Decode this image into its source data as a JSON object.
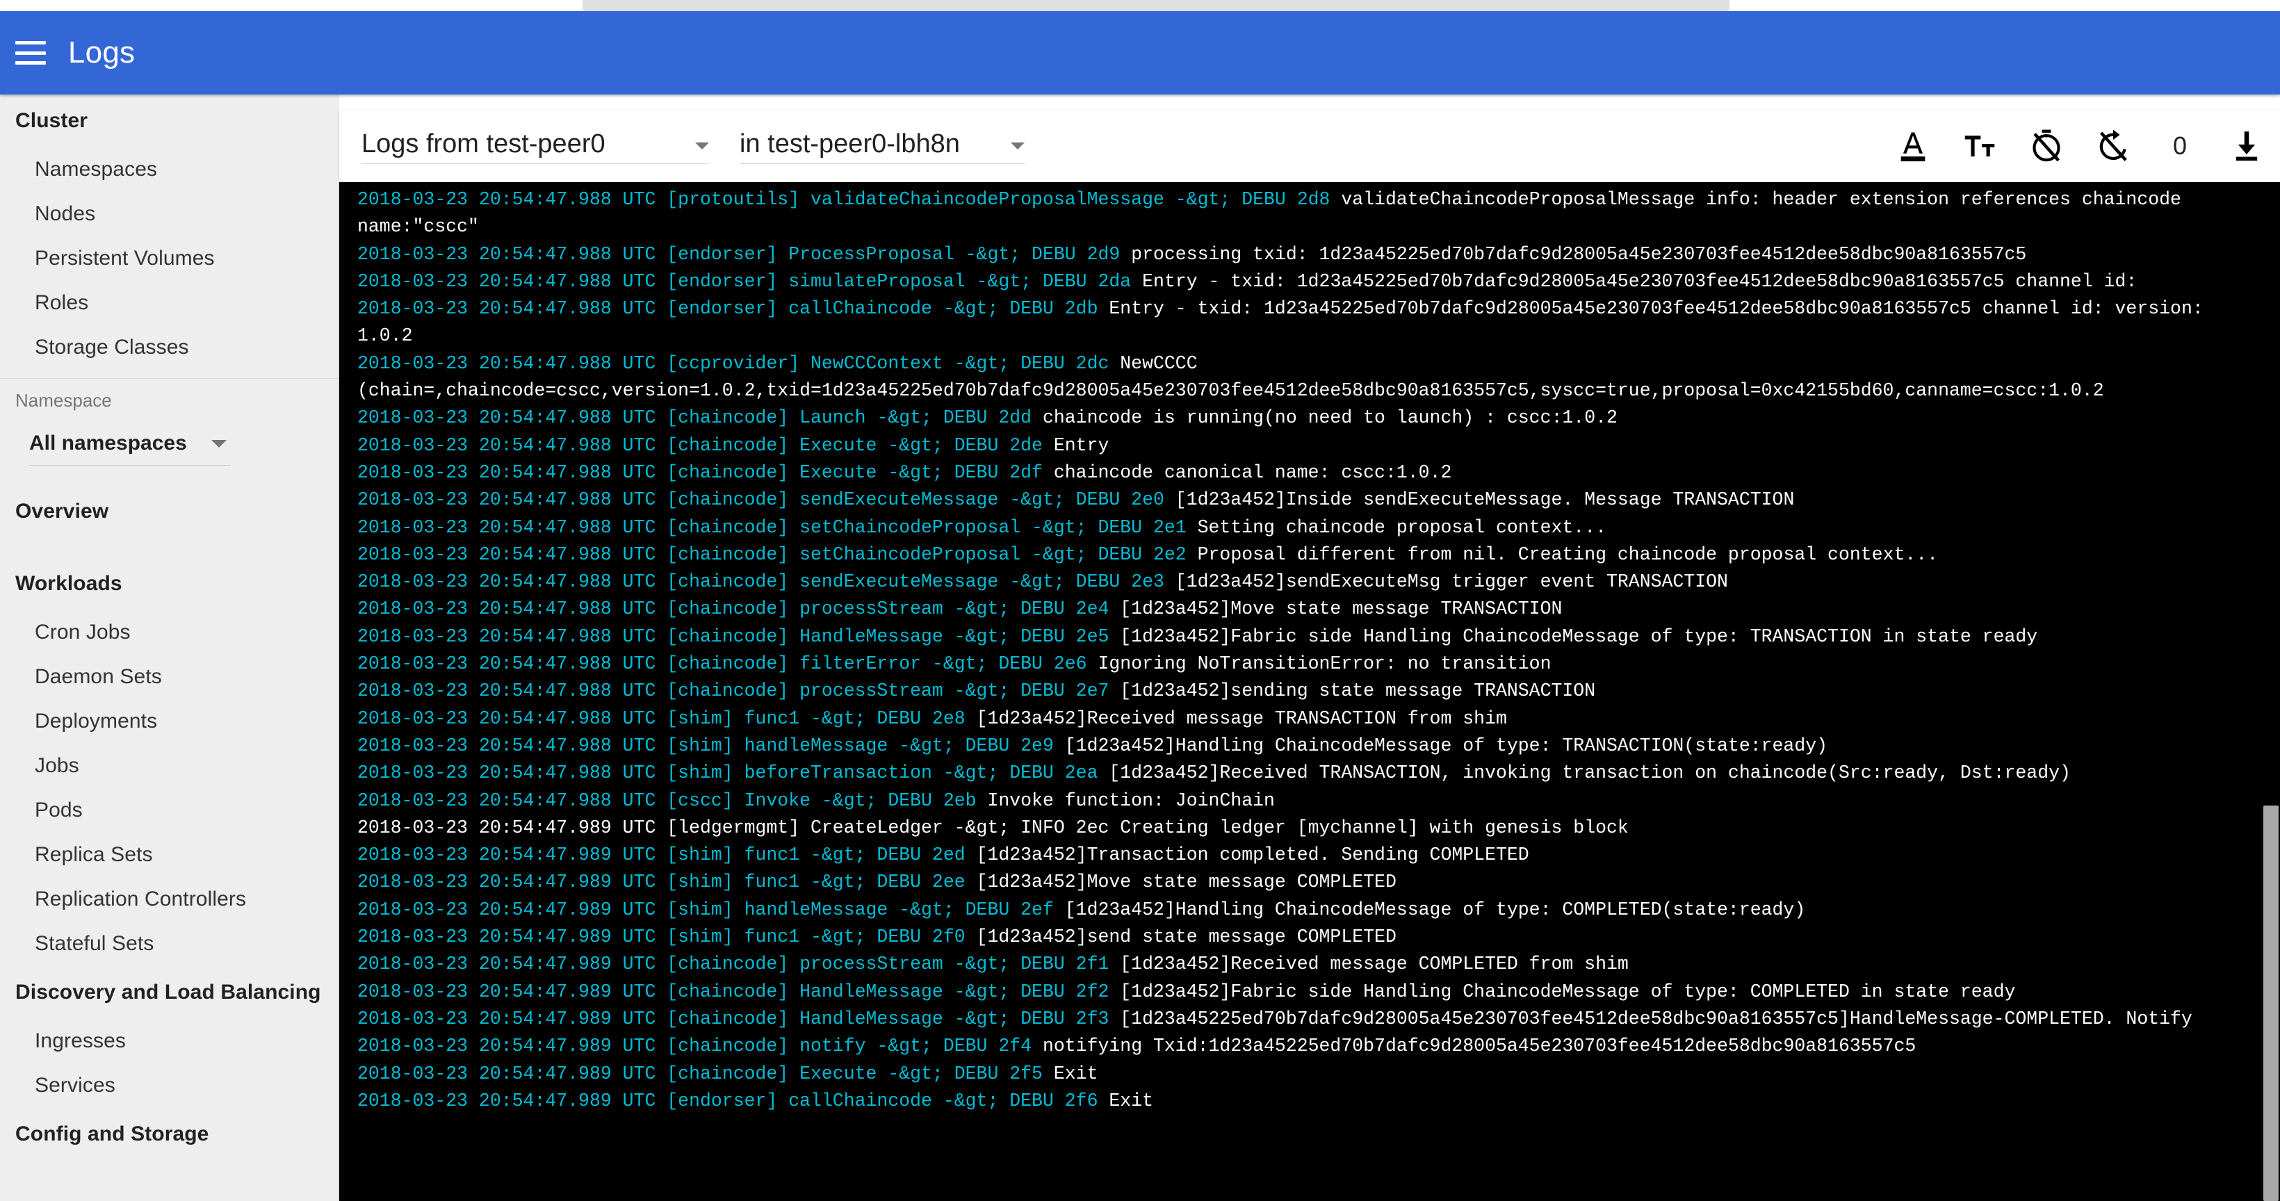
{
  "appbar": {
    "title": "Logs",
    "menu_icon": "hamburger-menu-icon"
  },
  "sidebar": {
    "sections": [
      {
        "title": "Cluster",
        "items": [
          "Namespaces",
          "Nodes",
          "Persistent Volumes",
          "Roles",
          "Storage Classes"
        ]
      }
    ],
    "namespace": {
      "label": "Namespace",
      "selected": "All namespaces"
    },
    "overview": "Overview",
    "workloads": {
      "title": "Workloads",
      "items": [
        "Cron Jobs",
        "Daemon Sets",
        "Deployments",
        "Jobs",
        "Pods",
        "Replica Sets",
        "Replication Controllers",
        "Stateful Sets"
      ]
    },
    "discovery": {
      "title": "Discovery and Load Balancing",
      "items": [
        "Ingresses",
        "Services"
      ]
    },
    "config": {
      "title": "Config and Storage"
    }
  },
  "toolbar": {
    "pod_selector": "Logs from test-peer0",
    "container_selector": "in test-peer0-lbh8n",
    "icons": [
      {
        "name": "font-color-icon",
        "label": "A"
      },
      {
        "name": "font-size-icon",
        "label": "Tt"
      },
      {
        "name": "timestamp-off-icon",
        "label": "timestamp-off"
      },
      {
        "name": "auto-refresh-off-icon",
        "label": "auto-refresh-off"
      }
    ],
    "count": "0",
    "download_icon": "download-icon"
  },
  "colors": {
    "appbar": "#3367d6",
    "sidebar": "#eeeeee",
    "console_bg": "#000000",
    "log_prefix": "#00bcd4",
    "log_text": "#ffffff"
  },
  "logs": [
    {
      "prefix": "2018-03-23 20:54:47.988 UTC [protoutils] validateChaincodeProposalMessage -&gt; DEBU 2d8 ",
      "message": "validateChaincodeProposalMessage info: header extension references chaincode name:\"cscc\"",
      "level": "DEBU"
    },
    {
      "prefix": "2018-03-23 20:54:47.988 UTC [endorser] ProcessProposal -&gt; DEBU 2d9 ",
      "message": "processing txid: 1d23a45225ed70b7dafc9d28005a45e230703fee4512dee58dbc90a8163557c5",
      "level": "DEBU"
    },
    {
      "prefix": "2018-03-23 20:54:47.988 UTC [endorser] simulateProposal -&gt; DEBU 2da ",
      "message": "Entry - txid: 1d23a45225ed70b7dafc9d28005a45e230703fee4512dee58dbc90a8163557c5 channel id:",
      "level": "DEBU"
    },
    {
      "prefix": "2018-03-23 20:54:47.988 UTC [endorser] callChaincode -&gt; DEBU 2db ",
      "message": "Entry - txid: 1d23a45225ed70b7dafc9d28005a45e230703fee4512dee58dbc90a8163557c5 channel id: version: 1.0.2",
      "level": "DEBU"
    },
    {
      "prefix": "2018-03-23 20:54:47.988 UTC [ccprovider] NewCCContext -&gt; DEBU 2dc ",
      "message": "NewCCCC (chain=,chaincode=cscc,version=1.0.2,txid=1d23a45225ed70b7dafc9d28005a45e230703fee4512dee58dbc90a8163557c5,syscc=true,proposal=0xc42155bd60,canname=cscc:1.0.2",
      "level": "DEBU"
    },
    {
      "prefix": "2018-03-23 20:54:47.988 UTC [chaincode] Launch -&gt; DEBU 2dd ",
      "message": "chaincode is running(no need to launch) : cscc:1.0.2",
      "level": "DEBU"
    },
    {
      "prefix": "2018-03-23 20:54:47.988 UTC [chaincode] Execute -&gt; DEBU 2de ",
      "message": "Entry",
      "level": "DEBU"
    },
    {
      "prefix": "2018-03-23 20:54:47.988 UTC [chaincode] Execute -&gt; DEBU 2df ",
      "message": "chaincode canonical name: cscc:1.0.2",
      "level": "DEBU"
    },
    {
      "prefix": "2018-03-23 20:54:47.988 UTC [chaincode] sendExecuteMessage -&gt; DEBU 2e0 ",
      "message": "[1d23a452]Inside sendExecuteMessage. Message TRANSACTION",
      "level": "DEBU"
    },
    {
      "prefix": "2018-03-23 20:54:47.988 UTC [chaincode] setChaincodeProposal -&gt; DEBU 2e1 ",
      "message": "Setting chaincode proposal context...",
      "level": "DEBU"
    },
    {
      "prefix": "2018-03-23 20:54:47.988 UTC [chaincode] setChaincodeProposal -&gt; DEBU 2e2 ",
      "message": "Proposal different from nil. Creating chaincode proposal context...",
      "level": "DEBU"
    },
    {
      "prefix": "2018-03-23 20:54:47.988 UTC [chaincode] sendExecuteMessage -&gt; DEBU 2e3 ",
      "message": "[1d23a452]sendExecuteMsg trigger event TRANSACTION",
      "level": "DEBU"
    },
    {
      "prefix": "2018-03-23 20:54:47.988 UTC [chaincode] processStream -&gt; DEBU 2e4 ",
      "message": "[1d23a452]Move state message TRANSACTION",
      "level": "DEBU"
    },
    {
      "prefix": "2018-03-23 20:54:47.988 UTC [chaincode] HandleMessage -&gt; DEBU 2e5 ",
      "message": "[1d23a452]Fabric side Handling ChaincodeMessage of type: TRANSACTION in state ready",
      "level": "DEBU"
    },
    {
      "prefix": "2018-03-23 20:54:47.988 UTC [chaincode] filterError -&gt; DEBU 2e6 ",
      "message": "Ignoring NoTransitionError: no transition",
      "level": "DEBU"
    },
    {
      "prefix": "2018-03-23 20:54:47.988 UTC [chaincode] processStream -&gt; DEBU 2e7 ",
      "message": "[1d23a452]sending state message TRANSACTION",
      "level": "DEBU"
    },
    {
      "prefix": "2018-03-23 20:54:47.988 UTC [shim] func1 -&gt; DEBU 2e8 ",
      "message": "[1d23a452]Received message TRANSACTION from shim",
      "level": "DEBU"
    },
    {
      "prefix": "2018-03-23 20:54:47.988 UTC [shim] handleMessage -&gt; DEBU 2e9 ",
      "message": "[1d23a452]Handling ChaincodeMessage of type: TRANSACTION(state:ready)",
      "level": "DEBU"
    },
    {
      "prefix": "2018-03-23 20:54:47.988 UTC [shim] beforeTransaction -&gt; DEBU 2ea ",
      "message": "[1d23a452]Received TRANSACTION, invoking transaction on chaincode(Src:ready, Dst:ready)",
      "level": "DEBU"
    },
    {
      "prefix": "2018-03-23 20:54:47.988 UTC [cscc] Invoke -&gt; DEBU 2eb ",
      "message": "Invoke function: JoinChain",
      "level": "DEBU"
    },
    {
      "prefix": "2018-03-23 20:54:47.989 UTC [ledgermgmt] CreateLedger -&gt; INFO 2ec ",
      "message": "Creating ledger [mychannel] with genesis block",
      "level": "INFO"
    },
    {
      "prefix": "2018-03-23 20:54:47.989 UTC [shim] func1 -&gt; DEBU 2ed ",
      "message": "[1d23a452]Transaction completed. Sending COMPLETED",
      "level": "DEBU"
    },
    {
      "prefix": "2018-03-23 20:54:47.989 UTC [shim] func1 -&gt; DEBU 2ee ",
      "message": "[1d23a452]Move state message COMPLETED",
      "level": "DEBU"
    },
    {
      "prefix": "2018-03-23 20:54:47.989 UTC [shim] handleMessage -&gt; DEBU 2ef ",
      "message": "[1d23a452]Handling ChaincodeMessage of type: COMPLETED(state:ready)",
      "level": "DEBU"
    },
    {
      "prefix": "2018-03-23 20:54:47.989 UTC [shim] func1 -&gt; DEBU 2f0 ",
      "message": "[1d23a452]send state message COMPLETED",
      "level": "DEBU"
    },
    {
      "prefix": "2018-03-23 20:54:47.989 UTC [chaincode] processStream -&gt; DEBU 2f1 ",
      "message": "[1d23a452]Received message COMPLETED from shim",
      "level": "DEBU"
    },
    {
      "prefix": "2018-03-23 20:54:47.989 UTC [chaincode] HandleMessage -&gt; DEBU 2f2 ",
      "message": "[1d23a452]Fabric side Handling ChaincodeMessage of type: COMPLETED in state ready",
      "level": "DEBU"
    },
    {
      "prefix": "2018-03-23 20:54:47.989 UTC [chaincode] HandleMessage -&gt; DEBU 2f3 ",
      "message": "[1d23a45225ed70b7dafc9d28005a45e230703fee4512dee58dbc90a8163557c5]HandleMessage-COMPLETED. Notify",
      "level": "DEBU"
    },
    {
      "prefix": "2018-03-23 20:54:47.989 UTC [chaincode] notify -&gt; DEBU 2f4 ",
      "message": "notifying Txid:1d23a45225ed70b7dafc9d28005a45e230703fee4512dee58dbc90a8163557c5",
      "level": "DEBU"
    },
    {
      "prefix": "2018-03-23 20:54:47.989 UTC [chaincode] Execute -&gt; DEBU 2f5 ",
      "message": "Exit",
      "level": "DEBU"
    },
    {
      "prefix": "2018-03-23 20:54:47.989 UTC [endorser] callChaincode -&gt; DEBU 2f6 ",
      "message": "Exit",
      "level": "DEBU"
    }
  ]
}
